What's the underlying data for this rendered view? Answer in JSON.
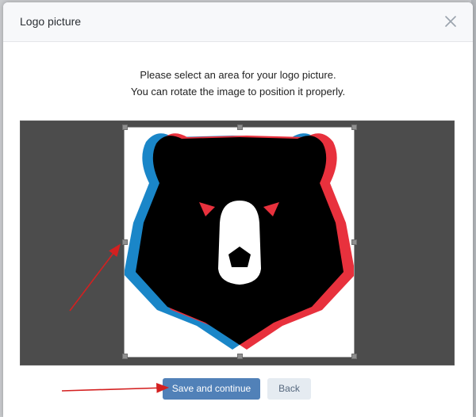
{
  "dialog": {
    "title": "Logo picture",
    "close_icon": "close-icon"
  },
  "instructions": {
    "line1": "Please select an area for your logo picture.",
    "line2": "You can rotate the image to position it properly."
  },
  "crop": {
    "image_description_icon": "bear-logo"
  },
  "buttons": {
    "save_label": "Save and continue",
    "back_label": "Back"
  },
  "colors": {
    "primary": "#5181b8",
    "secondary_bg": "#e5ebf1",
    "annotation_arrow": "#d42020",
    "logo_red": "#e8313d",
    "logo_blue": "#1a86c8"
  }
}
